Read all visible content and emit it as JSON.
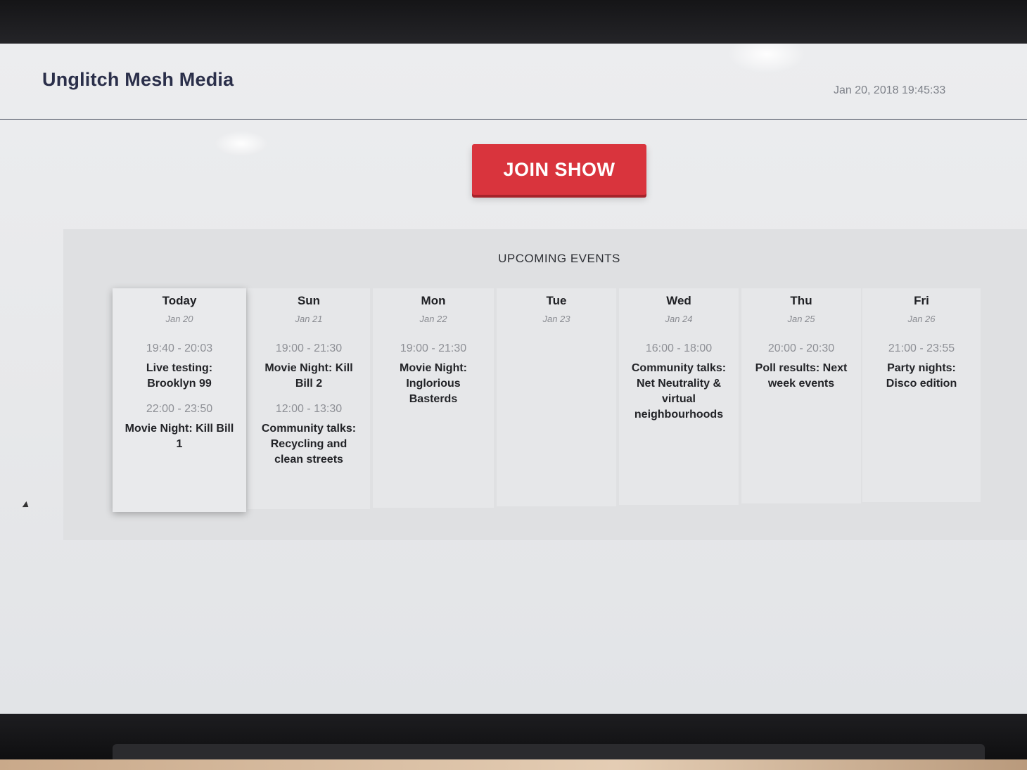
{
  "app": {
    "brand": "Unglitch Mesh Media",
    "datetime": "Jan 20, 2018 19:45:33"
  },
  "join_button": {
    "label": "JOIN SHOW"
  },
  "events": {
    "title": "UPCOMING EVENTS",
    "days": [
      {
        "name": "Today",
        "date": "Jan 20",
        "items": [
          {
            "time": "19:40 - 20:03",
            "title": "Live testing: Brooklyn 99"
          },
          {
            "time": "22:00 - 23:50",
            "title": "Movie Night: Kill Bill 1"
          }
        ]
      },
      {
        "name": "Sun",
        "date": "Jan 21",
        "items": [
          {
            "time": "19:00 - 21:30",
            "title": "Movie Night: Kill Bill 2"
          },
          {
            "time": "12:00 - 13:30",
            "title": "Community talks: Recycling and clean streets"
          }
        ]
      },
      {
        "name": "Mon",
        "date": "Jan 22",
        "items": [
          {
            "time": "19:00 - 21:30",
            "title": "Movie Night: Inglorious Basterds"
          }
        ]
      },
      {
        "name": "Tue",
        "date": "Jan 23",
        "items": []
      },
      {
        "name": "Wed",
        "date": "Jan 24",
        "items": [
          {
            "time": "16:00 - 18:00",
            "title": "Community talks: Net Neutrality & virtual neighbourhoods"
          }
        ]
      },
      {
        "name": "Thu",
        "date": "Jan 25",
        "items": [
          {
            "time": "20:00 - 20:30",
            "title": "Poll results: Next week events"
          }
        ]
      },
      {
        "name": "Fri",
        "date": "Jan 26",
        "items": [
          {
            "time": "21:00 - 23:55",
            "title": "Party nights: Disco edition"
          }
        ]
      }
    ]
  },
  "colors": {
    "accent": "#d9343d",
    "brand_text": "#2b2f4a",
    "panel_bg": "#dfe0e2"
  }
}
